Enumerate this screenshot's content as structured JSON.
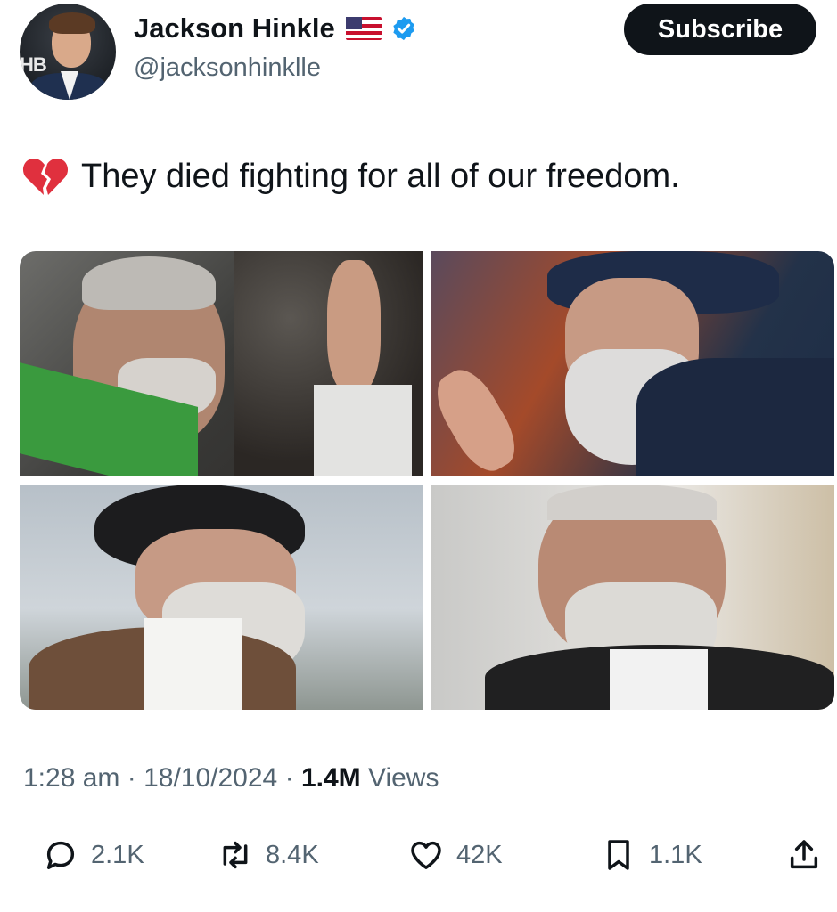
{
  "author": {
    "name": "Jackson Hinkle",
    "handle": "@jacksonhinklle",
    "flag_icon": "us-flag-icon",
    "verified_icon": "verified-badge-icon",
    "avatar_text": "HB"
  },
  "subscribe_label": "Subscribe",
  "tweet": {
    "emoji_icon": "broken-heart-icon",
    "text": "They died fighting for all of our freedom."
  },
  "meta": {
    "time": "1:28 am",
    "separator": "·",
    "date": "18/10/2024",
    "views_count": "1.4M",
    "views_label": "Views"
  },
  "actions": {
    "replies": "2.1K",
    "reposts": "8.4K",
    "likes": "42K",
    "bookmarks": "1.1K"
  },
  "colors": {
    "text": "#0f1419",
    "secondary": "#536471",
    "verified": "#1d9bf0",
    "button": "#0f1419"
  }
}
